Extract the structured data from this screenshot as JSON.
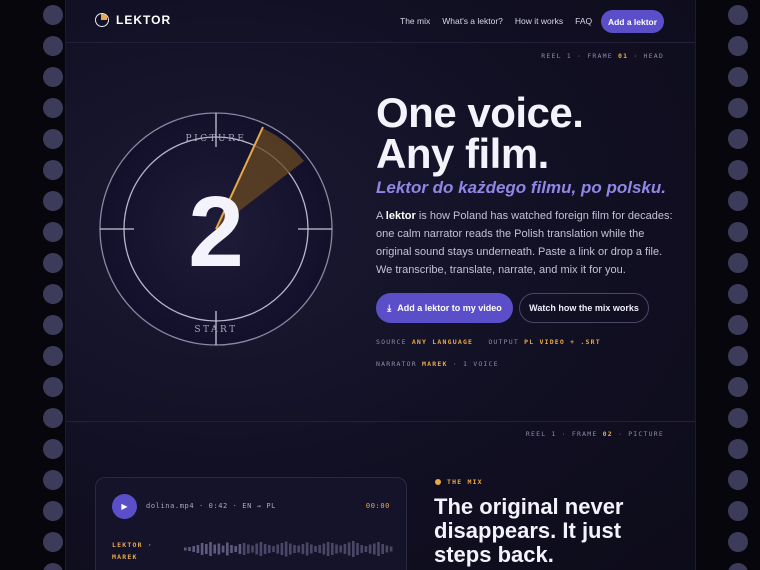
{
  "brand": {
    "name": "LEKTOR",
    "logo_icon": "reel-dial-icon",
    "accent": "#5b4fc9",
    "gold": "#e9a94a"
  },
  "nav": {
    "items": [
      "The mix",
      "What's a lektor?",
      "How it works",
      "FAQ"
    ],
    "cta": "Add a lektor"
  },
  "reel_top": {
    "prefix": "REEL 1 · FRAME",
    "frame": "01",
    "suffix": "· HEAD"
  },
  "dial": {
    "top_label": "PICTURE",
    "bottom_label": "START",
    "digit": "2"
  },
  "hero": {
    "headline_line1": "One voice.",
    "headline_line2": "Any film.",
    "subline": "Lektor do każdego filmu, po polsku.",
    "body_prefix": "A ",
    "body_bold": "lektor",
    "body_rest": " is how Poland has watched foreign film for decades: one calm narrator reads the Polish translation while the original sound stays underneath. Paste a link or drop a file. We transcribe, translate, narrate, and mix it for you.",
    "primary_button": "Add a lektor to my video",
    "primary_icon": "download-icon",
    "secondary_button": "Watch how the mix works"
  },
  "meta": {
    "source_label": "SOURCE",
    "source_value": "ANY LANGUAGE",
    "output_label": "OUTPUT",
    "output_value": "PL VIDEO + .SRT",
    "narrator_label": "NARRATOR",
    "narrator_value": "MAREK",
    "narrator_suffix": "· 1 VOICE"
  },
  "reel_bottom": {
    "prefix": "REEL 1 · FRAME",
    "frame": "02",
    "suffix": "· PICTURE"
  },
  "player": {
    "file": "dolina.mp4 · 0:42 · EN → PL",
    "timecode": "00:00",
    "track_line1": "LEKTOR ·",
    "track_line2": "MAREK",
    "play_icon": "play-icon"
  },
  "mix": {
    "eyebrow": "THE MIX",
    "title": "The original never disappears. It just steps back."
  }
}
